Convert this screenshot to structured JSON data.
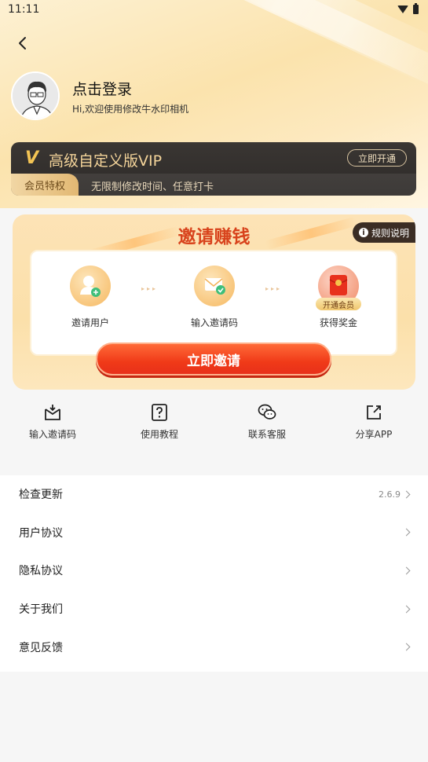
{
  "status_bar": {
    "time": "11:11",
    "icons": [
      "wifi-icon",
      "battery-icon"
    ]
  },
  "header": {
    "back_icon": "back-arrow-icon",
    "login_title": "点击登录",
    "login_subtitle": "Hi,欢迎使用修改牛水印相机"
  },
  "vip": {
    "logo": "V",
    "title": "高级自定义版VIP",
    "open_button": "立即开通",
    "tag": "会员特权",
    "privilege": "无限制修改时间、任意打卡",
    "colors": {
      "card": "#2f2b29",
      "gold": "#f3c454"
    }
  },
  "invite": {
    "title": "邀请赚钱",
    "rules_label": "规则说明",
    "steps": [
      {
        "label": "邀请用户",
        "icon": "add-user-icon"
      },
      {
        "label": "输入邀请码",
        "icon": "code-envelope-icon"
      },
      {
        "label": "获得奖金",
        "icon": "red-envelope-icon",
        "badge": "开通会员"
      }
    ],
    "button_label": "立即邀请",
    "colors": {
      "title": "#d8431c",
      "button": "#f03a18"
    }
  },
  "shortcuts": [
    {
      "label": "输入邀请码",
      "icon": "inbox-download-icon"
    },
    {
      "label": "使用教程",
      "icon": "question-icon"
    },
    {
      "label": "联系客服",
      "icon": "wechat-icon"
    },
    {
      "label": "分享APP",
      "icon": "share-icon"
    }
  ],
  "menu": [
    {
      "label": "检查更新",
      "value": "2.6.9"
    },
    {
      "label": "用户协议",
      "value": ""
    },
    {
      "label": "隐私协议",
      "value": ""
    },
    {
      "label": "关于我们",
      "value": ""
    },
    {
      "label": "意见反馈",
      "value": ""
    }
  ]
}
